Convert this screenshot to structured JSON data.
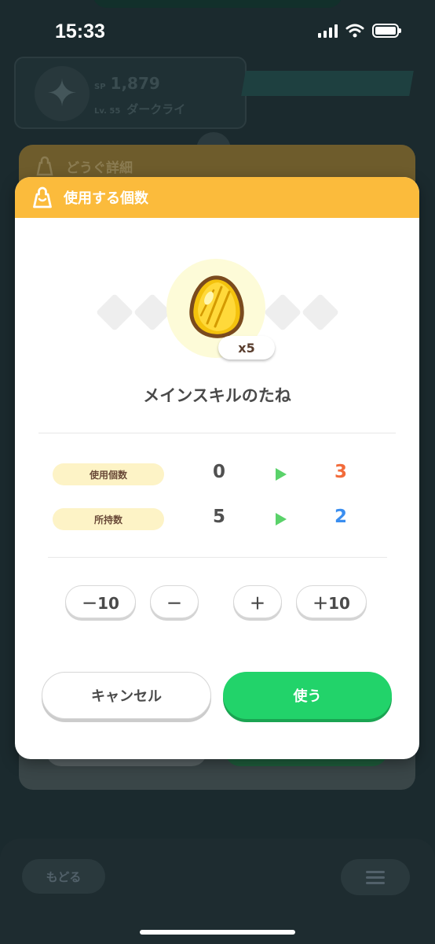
{
  "status_bar": {
    "time": "15:33"
  },
  "background": {
    "profile": {
      "sp_label": "SP",
      "sp_value": "1,879",
      "level_label": "Lv. 55",
      "pokemon_name": "ダークライ"
    },
    "item_detail_title": "どうぐ詳細",
    "back_button_label": "もどる"
  },
  "modal": {
    "title": "使用する個数",
    "item_name": "メインスキルのたね",
    "quantity_badge": "x5",
    "rows": [
      {
        "label": "使用個数",
        "current": "0",
        "new": "3",
        "new_color": "#f26b3a"
      },
      {
        "label": "所持数",
        "current": "5",
        "new": "2",
        "new_color": "#3a8ef0"
      }
    ],
    "steppers": {
      "minus10": "－10",
      "minus1": "－",
      "plus1": "＋",
      "plus10": "＋10"
    },
    "cancel_label": "キャンセル",
    "use_label": "使う"
  },
  "colors": {
    "header": "#fbbb3c",
    "use_button": "#22d36a",
    "label_pill": "#fdf3c6"
  }
}
